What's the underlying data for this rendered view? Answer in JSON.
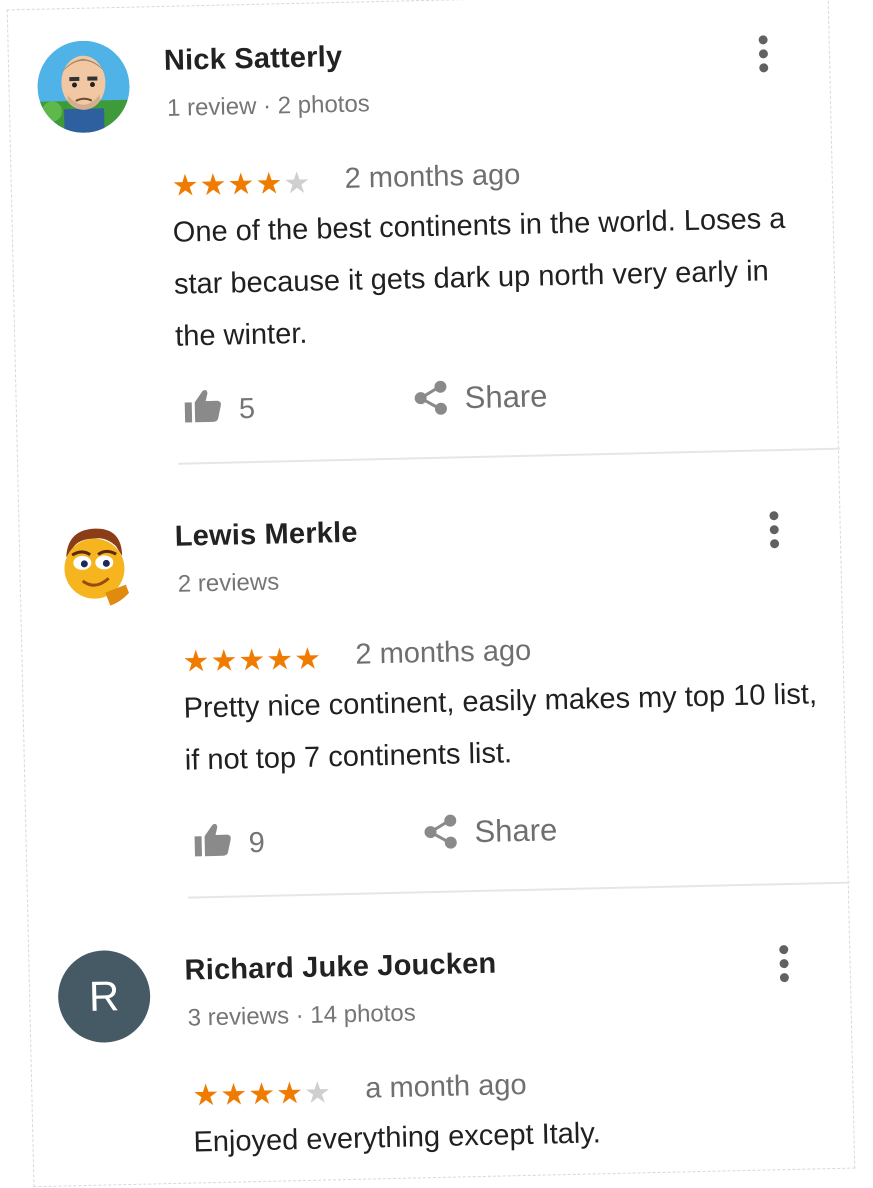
{
  "reviews": [
    {
      "name": "Nick Satterly",
      "meta": "1 review · 2 photos",
      "rating": 4,
      "max_rating": 5,
      "time": "2 months ago",
      "text": "One of the best continents in the world. Loses a star because it gets dark up north very early in the winter.",
      "likes": "5",
      "share_label": "Share",
      "avatar_icon": "cartoon-man-avatar-icon"
    },
    {
      "name": "Lewis Merkle",
      "meta": "2 reviews",
      "rating": 5,
      "max_rating": 5,
      "time": "2 months ago",
      "text": "Pretty nice continent, easily makes my top 10 list, if not top 7 continents list.",
      "likes": "9",
      "share_label": "Share",
      "avatar_icon": "cartoon-bee-avatar-icon"
    },
    {
      "name": "Richard Juke Joucken",
      "meta": "3 reviews · 14 photos",
      "rating": 4,
      "max_rating": 5,
      "time": "a month ago",
      "text": "Enjoyed everything except Italy.",
      "avatar_letter": "R",
      "avatar_icon": "letter-avatar-icon"
    }
  ],
  "colors": {
    "star_filled": "#ef7b00",
    "star_empty": "#cfcfcf",
    "letter_avatar_bg": "#465a66"
  }
}
